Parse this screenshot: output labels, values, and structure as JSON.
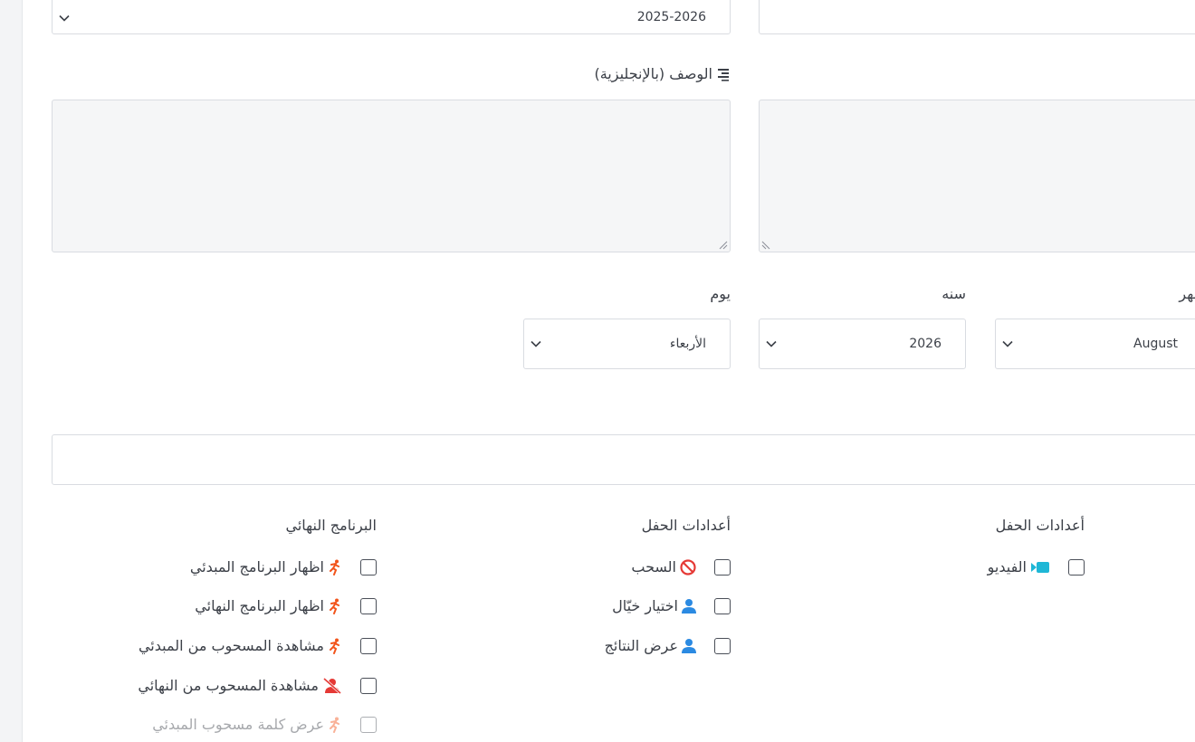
{
  "top_row": {
    "academic_year_value": "2025-2026"
  },
  "description_en": {
    "label": "الوصف (بالإنجليزية)",
    "icon": "align-right-icon"
  },
  "date": {
    "day_label": "يوم",
    "day_value": "الأربعاء",
    "year_label": "سنه",
    "year_value": "2026",
    "month_label": "شهر",
    "month_value": "August"
  },
  "groups": {
    "final_program": {
      "title": "البرنامج النهائي",
      "items": [
        {
          "label": "اظهار البرنامج المبدئي",
          "icon": "running-person-icon"
        },
        {
          "label": "اظهار البرنامج النهائي",
          "icon": "running-person-icon"
        },
        {
          "label": "مشاهدة المسحوب من المبدئي",
          "icon": "running-person-icon"
        },
        {
          "label": "مشاهدة المسحوب من النهائي",
          "icon": "user-slash-icon"
        },
        {
          "label": "عرض كلمة مسحوب المبدئي",
          "icon": "running-person-icon"
        }
      ]
    },
    "ceremony_settings_1": {
      "title": "أعدادات الحفل",
      "items": [
        {
          "label": "السحب",
          "icon": "ban-icon"
        },
        {
          "label": "اختيار خيّال",
          "icon": "user-icon"
        },
        {
          "label": "عرض النتائج",
          "icon": "user-icon"
        }
      ]
    },
    "ceremony_settings_2": {
      "title": "أعدادات الحفل",
      "items": [
        {
          "label": "الفيديو",
          "icon": "video-icon"
        }
      ]
    }
  },
  "colors": {
    "run_icon": "#f2541b",
    "ban_icon": "#e53935",
    "user_icon": "#2b8ae2",
    "video_icon": "#1fb7d6",
    "slash_icon": "#e53935"
  }
}
